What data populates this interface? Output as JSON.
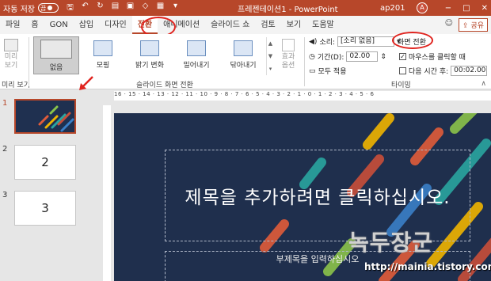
{
  "titlebar": {
    "autosave_label": "자동 저장",
    "autosave_state": "끔",
    "qa_icons": [
      "save-icon",
      "undo-icon",
      "redo-icon",
      "from-beginning-icon",
      "picture-icon",
      "shapes-icon",
      "table-icon",
      "dropdown-icon"
    ],
    "doc_title": "프레젠테이션1 - PowerPoint",
    "user": "ap201",
    "avatar_initial": "A",
    "window_buttons": [
      "−",
      "□",
      "✕"
    ]
  },
  "tabs": {
    "items": [
      "파일",
      "홈",
      "GON",
      "삽입",
      "디자인",
      "전환",
      "애니메이션",
      "슬라이드 쇼",
      "검토",
      "보기",
      "도움말"
    ],
    "active_index": 5,
    "share_label": "공유"
  },
  "ribbon": {
    "preview_label": "미리\n보기",
    "preview_group_label": "미리 보기",
    "transitions": [
      "없음",
      "모핑",
      "밝기 변화",
      "밀어내기",
      "닦아내기"
    ],
    "selected_transition": 0,
    "effect_options_label": "효과\n옵션",
    "transition_group_label": "슬라이드 화면 전환",
    "timing": {
      "sound_label": "소리:",
      "sound_value": "[소리 없음]",
      "duration_label": "기간(D):",
      "duration_value": "02.00",
      "apply_all_label": "모두 적용",
      "advance_label": "화면 전환",
      "on_click_label": "마우스를 클릭할 때",
      "on_click_checked": true,
      "after_label": "다음 시간 후:",
      "after_value": "00:02.00",
      "after_checked": false,
      "group_label": "타이밍"
    }
  },
  "slides_pane": {
    "slides": [
      {
        "number": "1",
        "label": ""
      },
      {
        "number": "2",
        "label": "2"
      },
      {
        "number": "3",
        "label": "3"
      }
    ]
  },
  "ruler": {
    "marks": "16 · 15 · 14 · 13 · 12 · 11 · 10 · 9 · 8 · 7 · 6 · 5 · 4 · 3 · 2 · 1 · 0 · 1 · 2 · 3 · 4 · 5 · 6"
  },
  "slide": {
    "title_placeholder": "제목을 추가하려면 클릭하십시오.",
    "subtitle_placeholder": "부제목을 입력하십시오"
  },
  "watermark": {
    "text": "녹두장군",
    "url": "http://mainia.tistory.com"
  },
  "colors": {
    "accent": "#b7472a",
    "highlight_circle": "#e0241f",
    "slide_bg": "#1f2f4d"
  }
}
